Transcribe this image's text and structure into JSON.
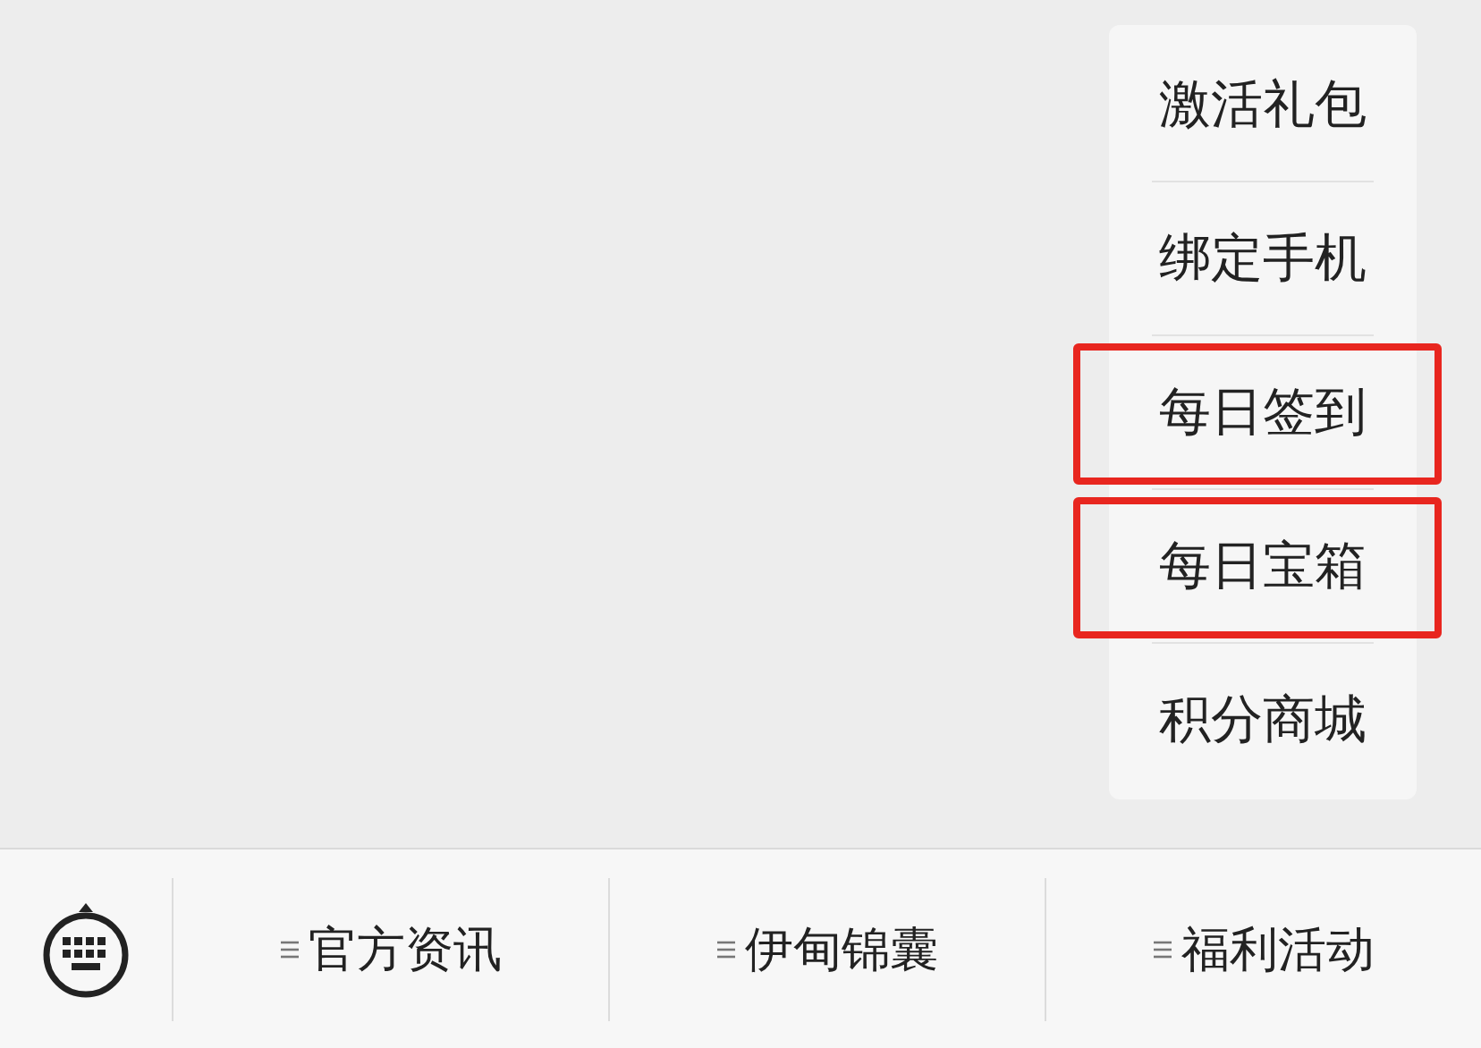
{
  "menu": {
    "items": [
      {
        "label": "激活礼包",
        "highlighted": false
      },
      {
        "label": "绑定手机",
        "highlighted": false
      },
      {
        "label": "每日签到",
        "highlighted": true
      },
      {
        "label": "每日宝箱",
        "highlighted": true
      },
      {
        "label": "积分商城",
        "highlighted": false
      }
    ]
  },
  "bottom_bar": {
    "tabs": [
      {
        "label": "官方资讯"
      },
      {
        "label": "伊甸锦囊"
      },
      {
        "label": "福利活动"
      }
    ]
  }
}
